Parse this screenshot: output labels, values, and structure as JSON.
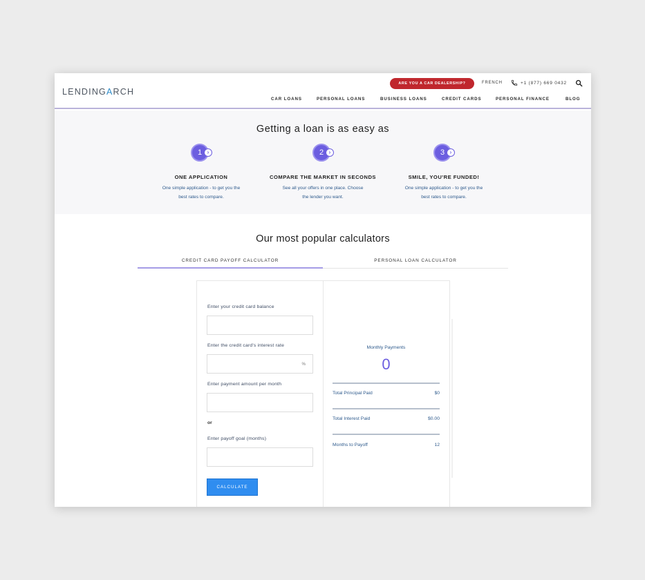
{
  "header": {
    "logo": {
      "pre": "LENDING",
      "arc": "A",
      "post": "RCH"
    },
    "dealer_button": "ARE YOU A CAR DEALERSHIP?",
    "language": "FRENCH",
    "phone": "+1 (877) 669 0432",
    "nav": [
      "CAR LOANS",
      "PERSONAL LOANS",
      "BUSINESS LOANS",
      "CREDIT CARDS",
      "PERSONAL FINANCE",
      "BLOG"
    ]
  },
  "steps_section": {
    "title": "Getting a loan is as easy as",
    "steps": [
      {
        "number": "1",
        "arrow": "›",
        "title": "ONE APPLICATION",
        "desc_line1": "One simple application - to get you the",
        "desc_line2": "best rates to compare."
      },
      {
        "number": "2",
        "arrow": "›",
        "title": "COMPARE THE MARKET IN SECONDS",
        "desc_line1": "See all your offers in one place. Choose",
        "desc_line2": "the lender you want."
      },
      {
        "number": "3",
        "arrow": "›",
        "title": "SMILE, YOU'RE FUNDED!",
        "desc_line1": "One simple application - to get you the",
        "desc_line2": "best rates to compare."
      }
    ]
  },
  "calculators": {
    "title": "Our most popular calculators",
    "tabs": [
      "CREDIT CARD PAYOFF CALCULATOR",
      "PERSONAL LOAN CALCULATOR"
    ],
    "active_tab": "CREDIT CARD PAYOFF CALCULATOR",
    "form": {
      "balance_label": "Enter your credit card balance",
      "interest_label": "Enter the credit card's interest rate",
      "interest_suffix": "%",
      "payment_label": "Enter payment amount per month",
      "or_text": "or",
      "goal_label": "Enter payoff goal (months)",
      "button": "CALCULATE"
    },
    "results": {
      "monthly_label": "Monthly Payments",
      "monthly_value": "0",
      "rows": [
        {
          "label": "Total Principal Paid",
          "value": "$0"
        },
        {
          "label": "Total Interest Paid",
          "value": "$0.00"
        },
        {
          "label": "Months to Payoff",
          "value": "12"
        }
      ]
    }
  },
  "colors": {
    "accent": "#6c5ee0",
    "dealer": "#c0272d",
    "button": "#2f8df0",
    "link_text": "#2e5a8c"
  }
}
